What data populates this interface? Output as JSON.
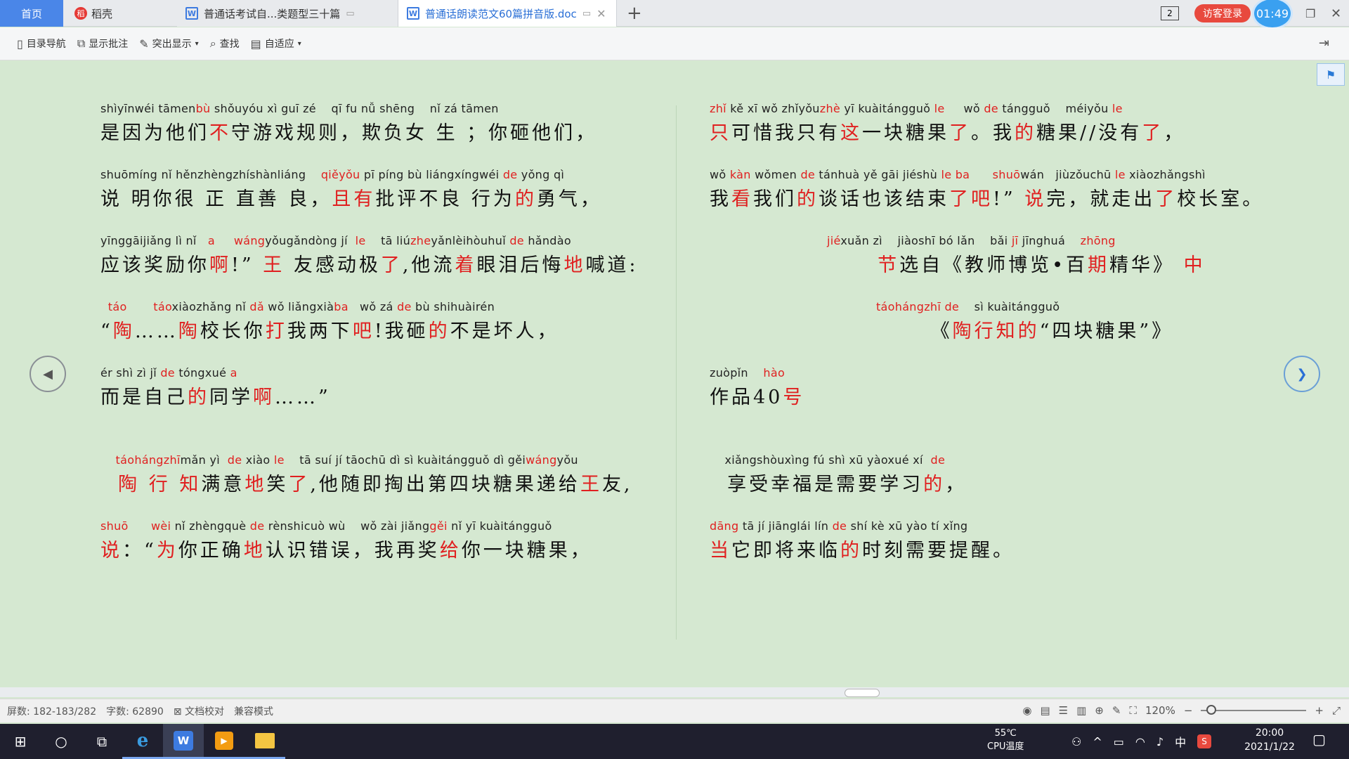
{
  "tabs": {
    "home": "首页",
    "daoke": "稻壳",
    "doc1": "普通话考试自...类题型三十篇",
    "doc2": "普通话朗读范文60篇拼音版.doc"
  },
  "titlebar": {
    "box_icon_label": "2",
    "visitor_login": "访客登录",
    "clock": "01:49"
  },
  "toolbar": {
    "toc_nav": "目录导航",
    "show_comments": "显示批注",
    "highlight": "突出显示",
    "find": "查找",
    "fit": "自适应"
  },
  "left_page": [
    {
      "py": [
        [
          "shìyīnwéi tāmen",
          0
        ],
        [
          "bù",
          1
        ],
        [
          " shǒuyóu xì guī zé    qī fu nǚ shēng    nǐ zá tāmen",
          0
        ]
      ],
      "zh": [
        [
          "是因为他们",
          0
        ],
        [
          "不",
          1
        ],
        [
          "守游戏规则，欺负女 生 ；你砸他们，",
          0
        ]
      ]
    },
    {
      "py": [
        [
          "shuōmíng nǐ hěnzhèngzhíshànliáng    ",
          0
        ],
        [
          "qiěyǒu",
          1
        ],
        [
          " pī píng bù liángxíngwéi ",
          0
        ],
        [
          "de",
          1
        ],
        [
          " yǒng qì",
          0
        ]
      ],
      "zh": [
        [
          "说 明你很 正 直善 良，",
          0
        ],
        [
          "且有",
          1
        ],
        [
          "批评不良 行为",
          0
        ],
        [
          "的",
          1
        ],
        [
          "勇气，",
          0
        ]
      ]
    },
    {
      "py": [
        [
          "yīnggāijiǎng lì nǐ   ",
          0
        ],
        [
          "a",
          1
        ],
        [
          "     ",
          0
        ],
        [
          "wáng",
          1
        ],
        [
          "yǒugǎndòng jí  ",
          0
        ],
        [
          "le",
          1
        ],
        [
          "    tā liú",
          0
        ],
        [
          "zhe",
          1
        ],
        [
          "yǎnlèihòuhuǐ ",
          0
        ],
        [
          "de",
          1
        ],
        [
          " hǎndào",
          0
        ]
      ],
      "zh": [
        [
          "应该奖励你",
          0
        ],
        [
          "啊",
          1
        ],
        [
          "!” ",
          0
        ],
        [
          "王",
          1
        ],
        [
          " 友感动极",
          0
        ],
        [
          "了",
          1
        ],
        [
          ",他流",
          0
        ],
        [
          "着",
          1
        ],
        [
          "眼泪后悔",
          0
        ],
        [
          "地",
          1
        ],
        [
          "喊道:",
          0
        ]
      ]
    },
    {
      "py": [
        [
          "  ",
          0
        ],
        [
          "táo",
          1
        ],
        [
          "       ",
          0
        ],
        [
          "táo",
          1
        ],
        [
          "xiàozhǎng nǐ ",
          0
        ],
        [
          "dǎ",
          1
        ],
        [
          " wǒ liǎngxià",
          0
        ],
        [
          "ba",
          1
        ],
        [
          "   wǒ zá ",
          0
        ],
        [
          "de",
          1
        ],
        [
          " bù shihuàirén",
          0
        ]
      ],
      "zh": [
        [
          "“",
          0
        ],
        [
          "陶",
          1
        ],
        [
          "……",
          0
        ],
        [
          "陶",
          1
        ],
        [
          "校长你",
          0
        ],
        [
          "打",
          1
        ],
        [
          "我两下",
          0
        ],
        [
          "吧",
          1
        ],
        [
          "!我砸",
          0
        ],
        [
          "的",
          1
        ],
        [
          "不是坏人，",
          0
        ]
      ]
    },
    {
      "py": [
        [
          "ér shì zì jǐ ",
          0
        ],
        [
          "de",
          1
        ],
        [
          " tóngxué ",
          0
        ],
        [
          "a",
          1
        ]
      ],
      "zh": [
        [
          "而是自己",
          0
        ],
        [
          "的",
          1
        ],
        [
          "同学",
          0
        ],
        [
          "啊",
          1
        ],
        [
          "……”",
          0
        ]
      ]
    },
    {
      "py": [],
      "zh": []
    },
    {
      "py": [
        [
          "    ",
          0
        ],
        [
          "táohángzhī",
          1
        ],
        [
          "mǎn yì  ",
          0
        ],
        [
          "de",
          1
        ],
        [
          " xiào ",
          0
        ],
        [
          "le",
          1
        ],
        [
          "    tā suí jí tāochū dì sì kuàitángguǒ dì gěi",
          0
        ],
        [
          "wáng",
          1
        ],
        [
          "yǒu",
          0
        ]
      ],
      "zh": [
        [
          "  ",
          0
        ],
        [
          "陶 行 知",
          1
        ],
        [
          "满意",
          0
        ],
        [
          "地",
          1
        ],
        [
          "笑",
          0
        ],
        [
          "了",
          1
        ],
        [
          ",他随即掏出第四块糖果递给",
          0
        ],
        [
          "王",
          1
        ],
        [
          "友,",
          0
        ]
      ]
    },
    {
      "py": [
        [
          "shuō",
          1
        ],
        [
          "      ",
          0
        ],
        [
          "wèi",
          1
        ],
        [
          " nǐ zhèngquè ",
          0
        ],
        [
          "de",
          1
        ],
        [
          " rènshicuò wù    wǒ zài jiǎng",
          0
        ],
        [
          "gěi",
          1
        ],
        [
          " nǐ yī kuàitángguǒ",
          0
        ]
      ],
      "zh": [
        [
          "说",
          1
        ],
        [
          "：“",
          0
        ],
        [
          "为",
          1
        ],
        [
          "你正确",
          0
        ],
        [
          "地",
          1
        ],
        [
          "认识错误，我再奖",
          0
        ],
        [
          "给",
          1
        ],
        [
          "你一块糖果，",
          0
        ]
      ]
    }
  ],
  "right_page": [
    {
      "py": [
        [
          "zhǐ",
          1
        ],
        [
          " kě xī wǒ zhǐyǒu",
          0
        ],
        [
          "zhè",
          1
        ],
        [
          " yī kuàitángguǒ ",
          0
        ],
        [
          "le",
          1
        ],
        [
          "     wǒ ",
          0
        ],
        [
          "de",
          1
        ],
        [
          " tángguǒ    méiyǒu ",
          0
        ],
        [
          "le",
          1
        ]
      ],
      "zh": [
        [
          "只",
          1
        ],
        [
          "可惜我只有",
          0
        ],
        [
          "这",
          1
        ],
        [
          "一块糖果",
          0
        ],
        [
          "了",
          1
        ],
        [
          "。我",
          0
        ],
        [
          "的",
          1
        ],
        [
          "糖果//没有",
          0
        ],
        [
          "了",
          1
        ],
        [
          "，",
          0
        ]
      ]
    },
    {
      "py": [
        [
          "wǒ ",
          0
        ],
        [
          "kàn",
          1
        ],
        [
          " wǒmen ",
          0
        ],
        [
          "de",
          1
        ],
        [
          " tánhuà yě gāi jiéshù ",
          0
        ],
        [
          "le ba",
          1
        ],
        [
          "      ",
          0
        ],
        [
          "shuō",
          1
        ],
        [
          "wán   jiùzǒuchū ",
          0
        ],
        [
          "le",
          1
        ],
        [
          " xiàozhǎngshì",
          0
        ]
      ],
      "zh": [
        [
          "我",
          0
        ],
        [
          "看",
          1
        ],
        [
          "我们",
          0
        ],
        [
          "的",
          1
        ],
        [
          "谈话也该结束",
          0
        ],
        [
          "了吧",
          1
        ],
        [
          "!” ",
          0
        ],
        [
          "说",
          1
        ],
        [
          "完，就走出",
          0
        ],
        [
          "了",
          1
        ],
        [
          "校长室。",
          0
        ]
      ]
    },
    {
      "py": [
        [
          "                               ",
          0
        ],
        [
          "jié",
          1
        ],
        [
          "xuǎn zì    jiàoshī bó lǎn    bǎi ",
          0
        ],
        [
          "jī",
          1
        ],
        [
          " jīnghuá    ",
          0
        ],
        [
          "zhōng",
          1
        ]
      ],
      "zh": [
        [
          "                   ",
          0
        ],
        [
          "节",
          1
        ],
        [
          "选自《教师博览•百",
          0
        ],
        [
          "期",
          1
        ],
        [
          "精华》 ",
          0
        ],
        [
          "中",
          1
        ]
      ]
    },
    {
      "py": [
        [
          "                                            ",
          0
        ],
        [
          "táohángzhī de",
          1
        ],
        [
          "    sì kuàitángguǒ",
          0
        ]
      ],
      "zh": [
        [
          "                         《",
          0
        ],
        [
          "陶行知的",
          1
        ],
        [
          "“四块糖果”》",
          0
        ]
      ]
    },
    {
      "py": [
        [
          "zuòpǐn    ",
          0
        ],
        [
          "hào",
          1
        ]
      ],
      "zh": [
        [
          "作品40",
          0
        ],
        [
          "号",
          1
        ]
      ]
    },
    {
      "py": [],
      "zh": []
    },
    {
      "py": [
        [
          "    xiǎngshòuxìng fú shì xū yàoxué xí  ",
          0
        ],
        [
          "de",
          1
        ]
      ],
      "zh": [
        [
          "  享受幸福是需要学习",
          0
        ],
        [
          "的",
          1
        ],
        [
          "，",
          0
        ]
      ]
    },
    {
      "py": [
        [
          "dāng",
          1
        ],
        [
          " tā jí jiānglái lín ",
          0
        ],
        [
          "de",
          1
        ],
        [
          " shí kè xū yào tí xǐng",
          0
        ]
      ],
      "zh": [
        [
          "当",
          1
        ],
        [
          "它即将来临",
          0
        ],
        [
          "的",
          1
        ],
        [
          "时刻需要提醒。",
          0
        ]
      ]
    }
  ],
  "status": {
    "screens": "屏数: 182-183/282",
    "words": "字数: 62890",
    "proofread": "文档校对",
    "compat": "兼容模式",
    "zoom": "120%"
  },
  "taskbar": {
    "temp": "55℃",
    "temp_label": "CPU温度",
    "ime": "中",
    "time": "20:00",
    "date": "2021/1/22"
  }
}
